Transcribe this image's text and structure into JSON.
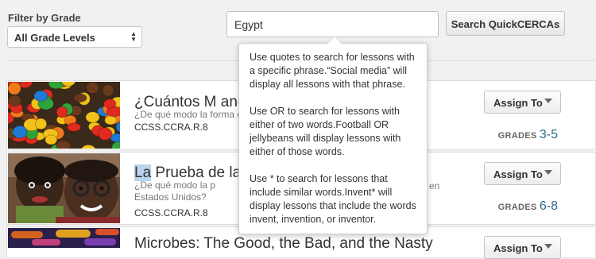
{
  "filter": {
    "label": "Filter by Grade",
    "selected": "All Grade Levels"
  },
  "search": {
    "value": "Egypt",
    "button_label": "Search QuickCERCAs"
  },
  "tooltip": {
    "paragraphs": [
      "Use quotes to search for lessons with a specific phrase.“Social media” will display all lessons with that phrase.",
      "Use OR to search for lessons with either of two words.Football OR jellybeans will display lessons with either of those words.",
      "Use * to search for lessons that include similar words.Invent* will display lessons that include the words invent, invention, or inventor."
    ]
  },
  "lessons": [
    {
      "title": "¿Cuántos M and M",
      "description": "¿De qué modo la forma de",
      "standard": "CCSS.CCRA.R.8",
      "assign_label": "Assign To",
      "grades_label": "GRADES",
      "grades_value": "3-5"
    },
    {
      "title_highlight": "La",
      "title_rest": " Prueba de la M",
      "description_line1": "¿De qué modo la p",
      "description_line1_tail": "en",
      "description_line2": "Estados Unidos?",
      "standard": "CCSS.CCRA.R.8",
      "assign_label": "Assign To",
      "grades_label": "GRADES",
      "grades_value": "6-8"
    },
    {
      "title": "Microbes: The Good, the Bad, and the Nasty",
      "assign_label": "Assign To"
    }
  ]
}
